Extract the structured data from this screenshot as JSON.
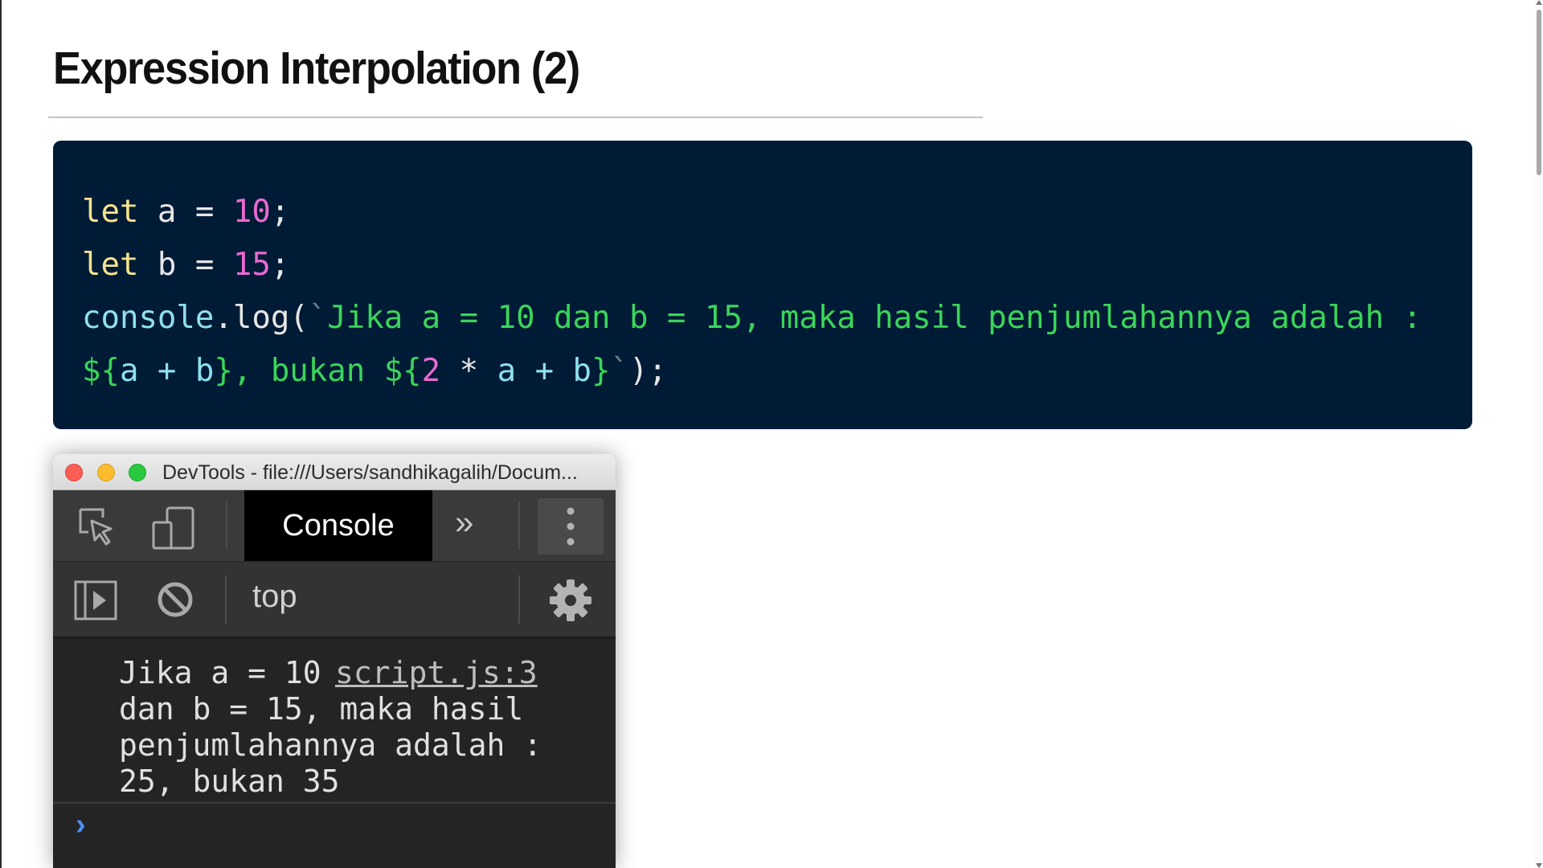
{
  "slide": {
    "title": "Expression Interpolation (2)"
  },
  "code": {
    "line1": {
      "kw": "let",
      "rest": " a = ",
      "num": "10",
      "end": ";"
    },
    "line2": {
      "kw": "let",
      "rest": " b = ",
      "num": "15",
      "end": ";"
    },
    "line3": {
      "fn": "console",
      "dot": ".log(",
      "tick": "`",
      "str": "Jika a = 10 dan b = 15, maka hasil penjumlahannya adalah :"
    },
    "line4": {
      "open1": "${",
      "expr1": "a + b",
      "close1": "}",
      "mid": ", bukan ",
      "open2": "${",
      "num": "2",
      "op": " * ",
      "expr2": "a + b",
      "close2": "}",
      "tick": "`",
      "end": ");"
    }
  },
  "devtools": {
    "window_title": "DevTools - file:///Users/sandhikagalih/Docum...",
    "console_tab": "Console",
    "more_tabs": "»",
    "context": "top",
    "log_lines": "Jika a = 10\ndan b = 15, maka hasil\npenjumlahannya adalah :\n25, bukan 35",
    "log_source": "script.js:3",
    "prompt": "›"
  },
  "colors": {
    "code_bg": "#001b35",
    "keyword": "#f5e38d",
    "number": "#e96ad2",
    "string": "#3bd45a",
    "function": "#8fe0ee"
  },
  "icons": [
    "inspect-element-icon",
    "device-toggle-icon",
    "kebab-menu-icon",
    "sidebar-toggle-icon",
    "clear-console-icon",
    "settings-gear-icon"
  ]
}
